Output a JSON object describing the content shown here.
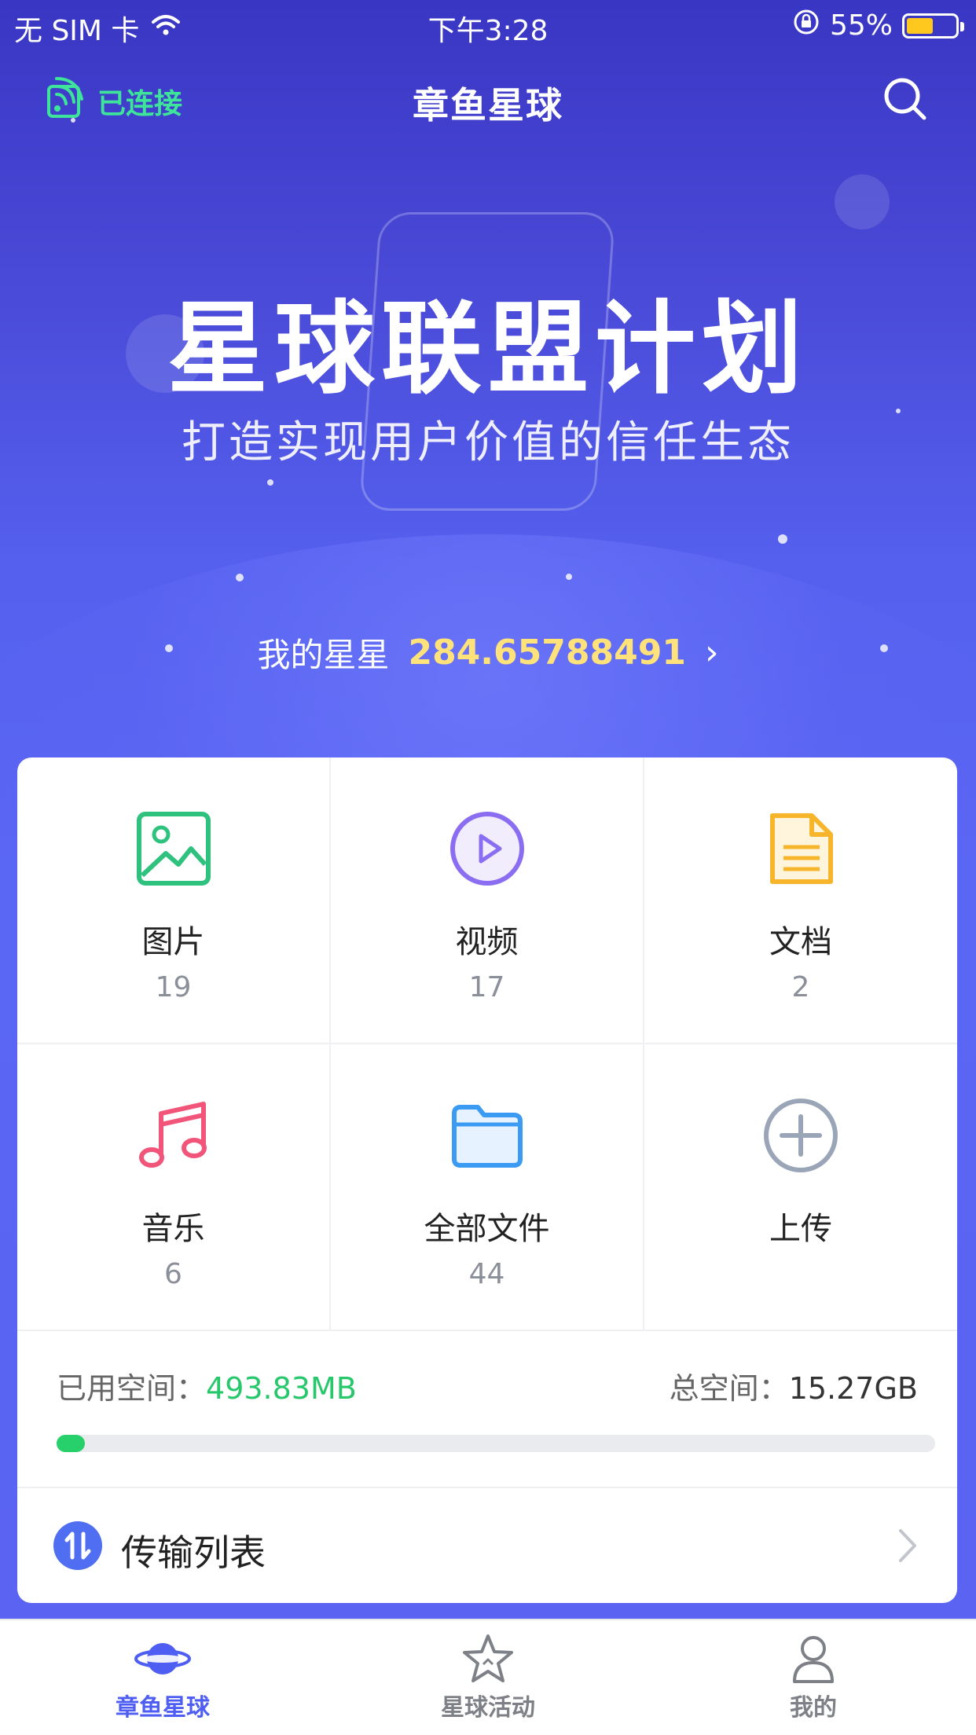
{
  "status_bar": {
    "carrier": "无 SIM 卡",
    "time": "下午3:28",
    "battery": "55%",
    "battery_level": 0.55
  },
  "nav": {
    "connected_label": "已连接",
    "title": "章鱼星球",
    "search_icon": "search-icon",
    "connected_icon": "router-signal-icon"
  },
  "banner": {
    "title": "星球联盟计划",
    "subtitle": "打造实现用户价值的信任生态"
  },
  "my_stars": {
    "label": "我的星星",
    "value": "284.65788491",
    "chevron": "›"
  },
  "categories": [
    {
      "label": "图片",
      "count": "19",
      "icon": "image-icon"
    },
    {
      "label": "视频",
      "count": "17",
      "icon": "play-icon"
    },
    {
      "label": "文档",
      "count": "2",
      "icon": "document-icon"
    },
    {
      "label": "音乐",
      "count": "6",
      "icon": "music-icon"
    },
    {
      "label": "全部文件",
      "count": "44",
      "icon": "folder-icon"
    },
    {
      "label": "上传",
      "count": "",
      "icon": "plus-circle-icon"
    }
  ],
  "storage": {
    "used_label": "已用空间：",
    "used_value": "493.83MB",
    "total_label": "总空间：",
    "total_value": "15.27GB",
    "used_fraction": 0.032
  },
  "transfer": {
    "label": "传输列表",
    "icon": "transfer-icon"
  },
  "tabs": [
    {
      "label": "章鱼星球",
      "icon": "planet-icon",
      "active": true
    },
    {
      "label": "星球活动",
      "icon": "star-icon",
      "active": false
    },
    {
      "label": "我的",
      "icon": "user-icon",
      "active": false
    }
  ],
  "colors": {
    "accent": "#4f5ef2",
    "connected": "#3ee49a",
    "stars_value": "#ffe27a",
    "used_value": "#27c76b"
  }
}
